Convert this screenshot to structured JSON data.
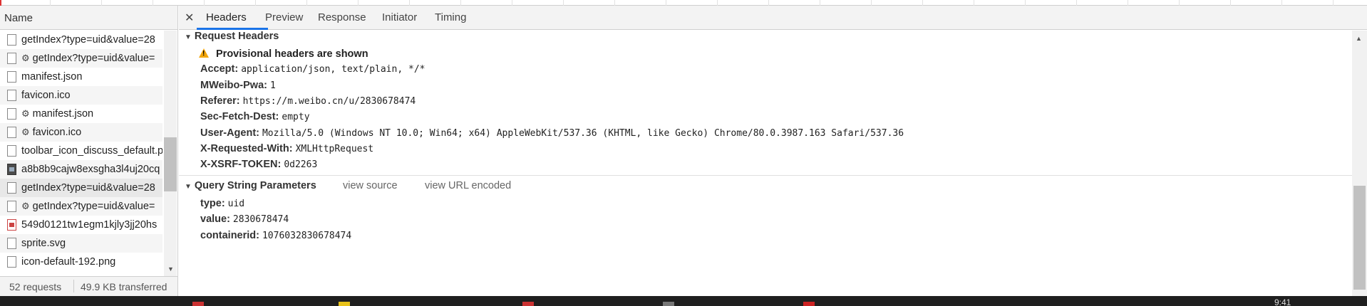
{
  "request_list": {
    "header": "Name",
    "items": [
      {
        "name": "getIndex?type=uid&value=28",
        "icon": "file",
        "gear": false
      },
      {
        "name": "getIndex?type=uid&value=",
        "icon": "file",
        "gear": true
      },
      {
        "name": "manifest.json",
        "icon": "file",
        "gear": false
      },
      {
        "name": "favicon.ico",
        "icon": "file",
        "gear": false
      },
      {
        "name": "manifest.json",
        "icon": "file",
        "gear": true
      },
      {
        "name": "favicon.ico",
        "icon": "file",
        "gear": true
      },
      {
        "name": "toolbar_icon_discuss_default.p",
        "icon": "file",
        "gear": false
      },
      {
        "name": "a8b8b9cajw8exsgha3l4uj20cq",
        "icon": "image",
        "gear": false
      },
      {
        "name": "getIndex?type=uid&value=28",
        "icon": "file",
        "gear": false
      },
      {
        "name": "getIndex?type=uid&value=",
        "icon": "file",
        "gear": true
      },
      {
        "name": "549d0121tw1egm1kjly3jj20hs",
        "icon": "image-red",
        "gear": false
      },
      {
        "name": "sprite.svg",
        "icon": "file",
        "gear": false
      },
      {
        "name": "icon-default-192.png",
        "icon": "file",
        "gear": false
      }
    ],
    "footer": {
      "requests": "52 requests",
      "transferred": "49.9 KB transferred"
    }
  },
  "tabs": [
    "Headers",
    "Preview",
    "Response",
    "Initiator",
    "Timing"
  ],
  "active_tab": "Headers",
  "request_headers": {
    "title": "Request Headers",
    "warning": "Provisional headers are shown",
    "rows": [
      {
        "key": "Accept:",
        "value": "application/json, text/plain, */*"
      },
      {
        "key": "MWeibo-Pwa:",
        "value": "1"
      },
      {
        "key": "Referer:",
        "value": "https://m.weibo.cn/u/2830678474"
      },
      {
        "key": "Sec-Fetch-Dest:",
        "value": "empty"
      },
      {
        "key": "User-Agent:",
        "value": "Mozilla/5.0 (Windows NT 10.0; Win64; x64) AppleWebKit/537.36 (KHTML, like Gecko) Chrome/80.0.3987.163 Safari/537.36"
      },
      {
        "key": "X-Requested-With:",
        "value": "XMLHttpRequest"
      },
      {
        "key": "X-XSRF-TOKEN:",
        "value": "0d2263"
      }
    ]
  },
  "query_string": {
    "title": "Query String Parameters",
    "view_source": "view source",
    "view_url_encoded": "view URL encoded",
    "rows": [
      {
        "key": "type:",
        "value": "uid"
      },
      {
        "key": "value:",
        "value": "2830678474"
      },
      {
        "key": "containerid:",
        "value": "1076032830678474"
      }
    ]
  },
  "taskbar": {
    "clock": "9:41"
  },
  "colors": {
    "active_tab": "#1a73e8",
    "warning": "#f2a60d"
  }
}
